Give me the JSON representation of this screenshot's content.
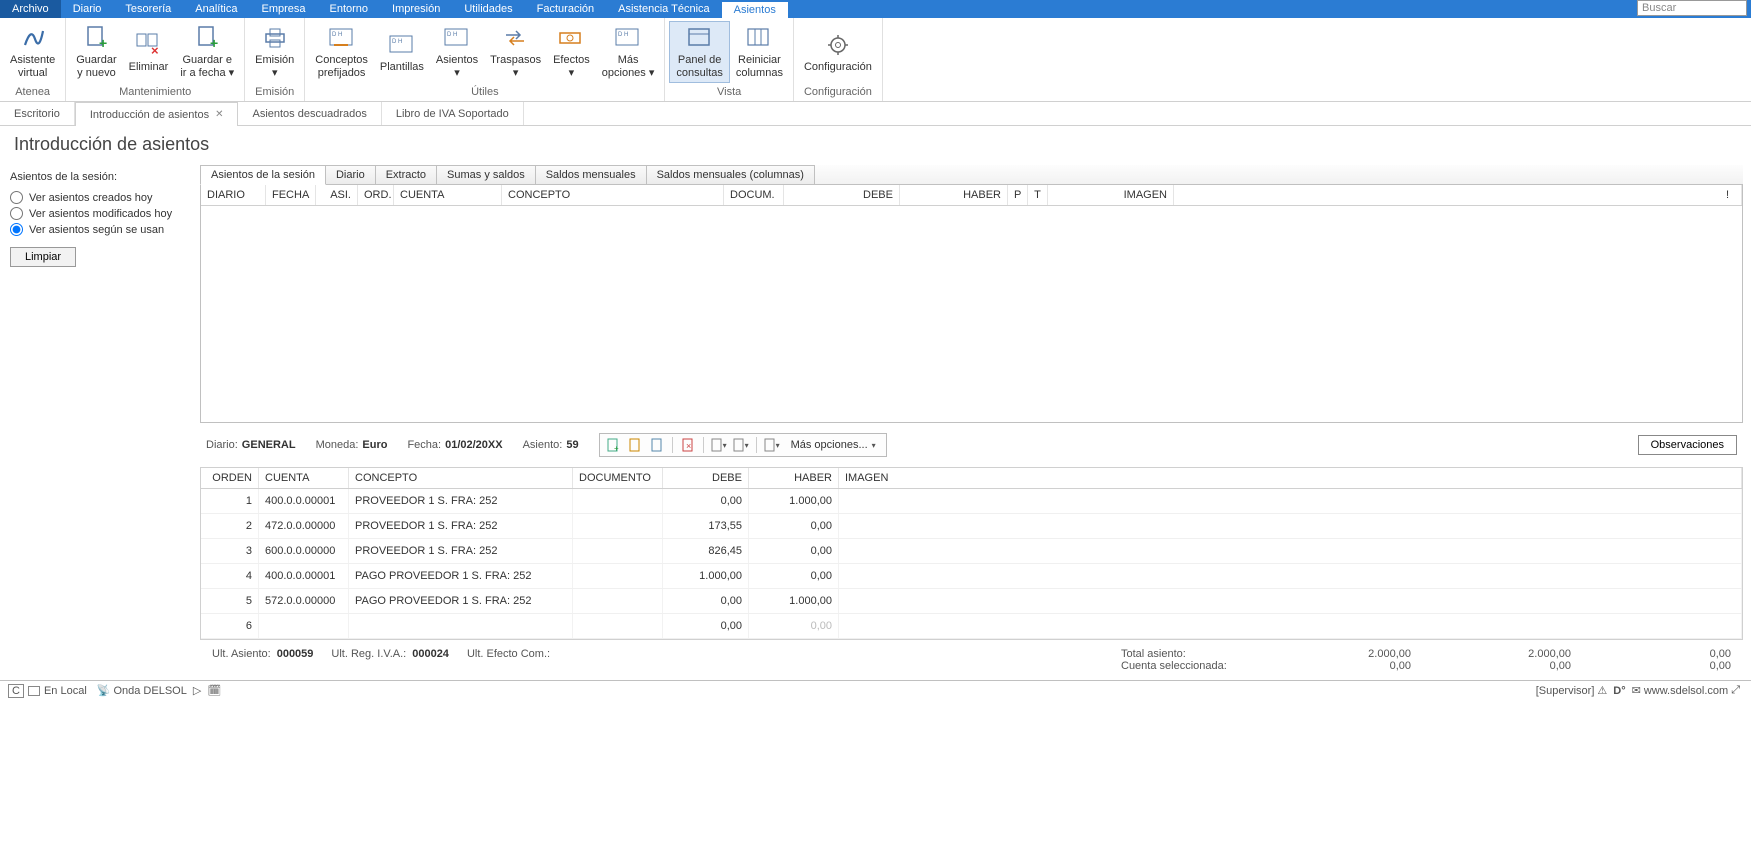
{
  "menu": {
    "items": [
      "Archivo",
      "Diario",
      "Tesorería",
      "Analítica",
      "Empresa",
      "Entorno",
      "Impresión",
      "Utilidades",
      "Facturación",
      "Asistencia Técnica",
      "Asientos"
    ],
    "active": "Asientos",
    "search_placeholder": "Buscar"
  },
  "ribbon": {
    "groups": [
      {
        "title": "Atenea",
        "items": [
          {
            "label": "Asistente\nvirtual",
            "icon": "alpha"
          }
        ]
      },
      {
        "title": "Mantenimiento",
        "items": [
          {
            "label": "Guardar\ny nuevo",
            "icon": "doc-plus"
          },
          {
            "label": "Eliminar",
            "icon": "doc-x"
          },
          {
            "label": "Guardar e\nir a fecha ▾",
            "icon": "doc-plus"
          }
        ]
      },
      {
        "title": "Emisión",
        "items": [
          {
            "label": "Emisión\n▾",
            "icon": "print"
          }
        ]
      },
      {
        "title": "Útiles",
        "items": [
          {
            "label": "Conceptos\nprefijados",
            "icon": "dm"
          },
          {
            "label": "Plantillas",
            "icon": "dm"
          },
          {
            "label": "Asientos\n▾",
            "icon": "dm"
          },
          {
            "label": "Traspasos\n▾",
            "icon": "transfer"
          },
          {
            "label": "Efectos\n▾",
            "icon": "cash"
          },
          {
            "label": "Más\nopciones ▾",
            "icon": "dm"
          }
        ]
      },
      {
        "title": "Vista",
        "items": [
          {
            "label": "Panel de\nconsultas",
            "icon": "panel",
            "active": true
          },
          {
            "label": "Reiniciar\ncolumnas",
            "icon": "grid"
          }
        ]
      },
      {
        "title": "Configuración",
        "items": [
          {
            "label": "Configuración",
            "icon": "gear"
          }
        ]
      }
    ]
  },
  "doc_tabs": {
    "items": [
      {
        "label": "Escritorio",
        "close": false
      },
      {
        "label": "Introducción de asientos",
        "close": true,
        "active": true
      },
      {
        "label": "Asientos descuadrados",
        "close": false
      },
      {
        "label": "Libro de IVA Soportado",
        "close": false
      }
    ]
  },
  "page_title": "Introducción de asientos",
  "left_panel": {
    "title": "Asientos de la sesión:",
    "radios": [
      {
        "label": "Ver asientos creados hoy"
      },
      {
        "label": "Ver asientos modificados hoy"
      },
      {
        "label": "Ver asientos según se usan",
        "checked": true
      }
    ],
    "clear": "Limpiar"
  },
  "sub_tabs": [
    "Asientos de la sesión",
    "Diario",
    "Extracto",
    "Sumas y saldos",
    "Saldos mensuales",
    "Saldos mensuales (columnas)"
  ],
  "sub_tabs_active": "Asientos de la sesión",
  "top_grid_headers": [
    "DIARIO",
    "FECHA",
    "ASI.",
    "ORD.",
    "CUENTA",
    "CONCEPTO",
    "DOCUM.",
    "DEBE",
    "HABER",
    "P",
    "T",
    "IMAGEN",
    "!"
  ],
  "entry_header": {
    "diario_l": "Diario:",
    "diario_v": "GENERAL",
    "moneda_l": "Moneda:",
    "moneda_v": "Euro",
    "fecha_l": "Fecha:",
    "fecha_v": "01/02/20XX",
    "asiento_l": "Asiento:",
    "asiento_v": "59",
    "mas_opciones": "Más opciones...",
    "observaciones": "Observaciones"
  },
  "lower_headers": [
    "ORDEN",
    "CUENTA",
    "CONCEPTO",
    "DOCUMENTO",
    "DEBE",
    "HABER",
    "IMAGEN"
  ],
  "lower_rows": [
    {
      "orden": "1",
      "cuenta": "400.0.0.00001",
      "concepto": "PROVEEDOR 1 S. FRA:  252",
      "docum": "",
      "debe": "0,00",
      "haber": "1.000,00"
    },
    {
      "orden": "2",
      "cuenta": "472.0.0.00000",
      "concepto": "PROVEEDOR 1 S. FRA:  252",
      "docum": "",
      "debe": "173,55",
      "haber": "0,00"
    },
    {
      "orden": "3",
      "cuenta": "600.0.0.00000",
      "concepto": "PROVEEDOR 1 S. FRA:  252",
      "docum": "",
      "debe": "826,45",
      "haber": "0,00"
    },
    {
      "orden": "4",
      "cuenta": "400.0.0.00001",
      "concepto": "PAGO PROVEEDOR 1 S. FRA:  252",
      "docum": "",
      "debe": "1.000,00",
      "haber": "0,00"
    },
    {
      "orden": "5",
      "cuenta": "572.0.0.00000",
      "concepto": "PAGO PROVEEDOR 1 S. FRA:  252",
      "docum": "",
      "debe": "0,00",
      "haber": "1.000,00"
    },
    {
      "orden": "6",
      "cuenta": "",
      "concepto": "",
      "docum": "",
      "debe": "0,00",
      "haber": "0,00",
      "editing": true
    }
  ],
  "footer": {
    "ult_asiento_l": "Ult. Asiento:",
    "ult_asiento_v": "000059",
    "ult_reg_iva_l": "Ult. Reg. I.V.A.:",
    "ult_reg_iva_v": "000024",
    "ult_efecto_l": "Ult. Efecto Com.:",
    "ult_efecto_v": "",
    "total_asiento_l": "Total asiento:",
    "cuenta_sel_l": "Cuenta seleccionada:",
    "col1": "2.000,00",
    "col2": "2.000,00",
    "col3": "0,00",
    "cs1": "0,00",
    "cs2": "0,00",
    "cs3": "0,00"
  },
  "statusbar": {
    "c": "C",
    "en_local": "En Local",
    "onda": "Onda DELSOL",
    "supervisor": "[Supervisor]",
    "site": "www.sdelsol.com"
  }
}
